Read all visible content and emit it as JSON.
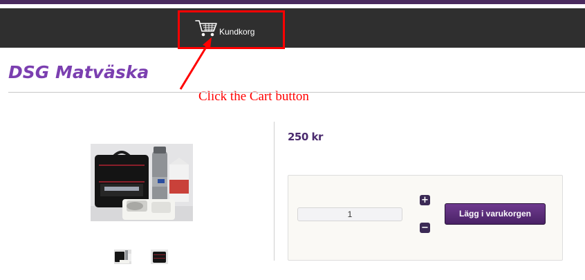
{
  "header": {
    "cart_icon": "shopping-cart-icon",
    "cart_label": "Kundkorg"
  },
  "annotation": {
    "instruction": "Click the Cart button",
    "color": "#ff0000"
  },
  "product": {
    "title": "DSG Matväska",
    "price": "250 kr",
    "quantity": "1",
    "increase_symbol": "+",
    "decrease_symbol": "−",
    "add_to_cart_label": "Lägg i varukorgen"
  },
  "colors": {
    "brand_purple": "#7b3fb0",
    "nav_bg": "#2f2f2f",
    "button_purple": "#5a2c7a"
  }
}
